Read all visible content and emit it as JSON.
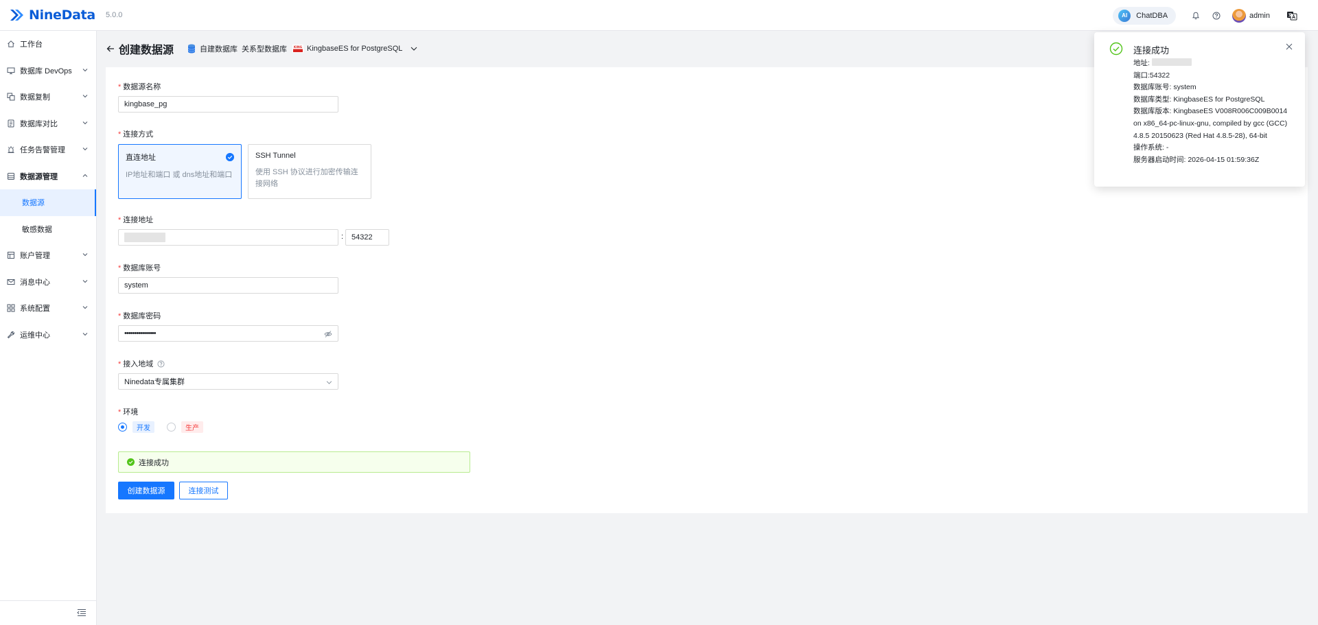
{
  "header": {
    "logo_text": "NineData",
    "version": "5.0.0",
    "chatdba_badge": "AI",
    "chatdba_label": "ChatDBA",
    "user_name": "admin",
    "brand_color": "#0a5cd7"
  },
  "sidebar": {
    "items": [
      {
        "label": "工作台",
        "icon": "home-icon"
      },
      {
        "label": "数据库 DevOps",
        "icon": "monitor-icon"
      },
      {
        "label": "数据复制",
        "icon": "copy-icon"
      },
      {
        "label": "数据库对比",
        "icon": "compare-icon"
      },
      {
        "label": "任务告警管理",
        "icon": "alarm-icon"
      },
      {
        "label": "数据源管理",
        "icon": "database-icon"
      },
      {
        "label": "账户管理",
        "icon": "account-icon"
      },
      {
        "label": "消息中心",
        "icon": "mail-icon"
      },
      {
        "label": "系统配置",
        "icon": "grid-icon"
      },
      {
        "label": "运维中心",
        "icon": "wrench-icon"
      }
    ],
    "sub_items": [
      {
        "label": "数据源"
      },
      {
        "label": "敏感数据"
      }
    ]
  },
  "page": {
    "title": "创建数据源",
    "breadcrumb": [
      "自建数据库",
      "关系型数据库",
      "KingbaseES for PostgreSQL"
    ],
    "kb_logo_text": "KING"
  },
  "form": {
    "name_label": "数据源名称",
    "name_value": "kingbase_pg",
    "conn_label": "连接方式",
    "conn_options": [
      {
        "title": "直连地址",
        "desc": "IP地址和端口 或 dns地址和端口",
        "selected": true
      },
      {
        "title": "SSH Tunnel",
        "desc": "使用 SSH 协议进行加密传输连接网络",
        "selected": false
      }
    ],
    "addr_label": "连接地址",
    "addr_sep": ":",
    "port_value": "54322",
    "account_label": "数据库账号",
    "account_value": "system",
    "password_label": "数据库密码",
    "password_value": "••••••••••••••••",
    "region_label": "接入地域",
    "region_value": "Ninedata专属集群",
    "env_label": "环境",
    "env_options": [
      {
        "label": "开发",
        "checked": true
      },
      {
        "label": "生产",
        "checked": false
      }
    ],
    "success_text": "连接成功",
    "create_button": "创建数据源",
    "test_button": "连接测试"
  },
  "notification": {
    "title": "连接成功",
    "lines": [
      "地址: ",
      "端口:54322",
      "数据库账号: system",
      "数据库类型: KingbaseES for PostgreSQL",
      "数据库版本: KingbaseES V008R006C009B0014 on x86_64-pc-linux-gnu, compiled by gcc (GCC) 4.8.5 20150623 (Red Hat 4.8.5-28), 64-bit",
      "操作系统: -",
      "服务器启动时间: 2026-04-15 01:59:36Z"
    ]
  }
}
